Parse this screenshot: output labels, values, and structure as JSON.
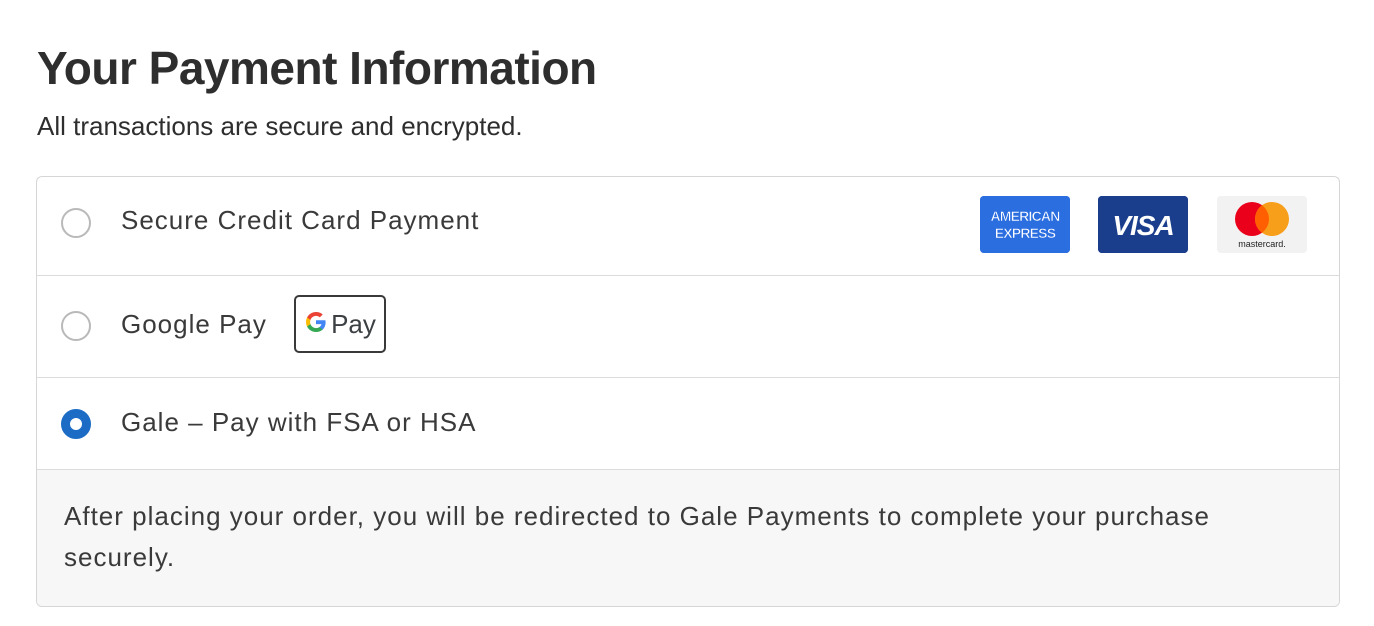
{
  "header": {
    "title": "Your Payment Information",
    "subtitle": "All transactions are secure and encrypted."
  },
  "options": [
    {
      "id": "credit-card",
      "label": "Secure Credit Card Payment",
      "selected": false,
      "brands": [
        {
          "name": "amex-logo",
          "text_top": "AMERICAN",
          "text_bottom": "EXPRESS"
        },
        {
          "name": "visa-logo",
          "text": "VISA"
        },
        {
          "name": "mastercard-logo",
          "text": "mastercard."
        }
      ]
    },
    {
      "id": "google-pay",
      "label": "Google Pay",
      "selected": false,
      "button_text": "Pay"
    },
    {
      "id": "gale",
      "label": "Gale – Pay with FSA or HSA",
      "selected": true
    }
  ],
  "info": {
    "text": "After placing your order, you will be redirected to Gale Payments to complete your purchase securely."
  },
  "colors": {
    "accent": "#1c6bc4",
    "amex": "#2b6ee0",
    "visa": "#1a3e8c",
    "mastercard_red": "#eb001b",
    "mastercard_orange": "#f79e1b"
  }
}
